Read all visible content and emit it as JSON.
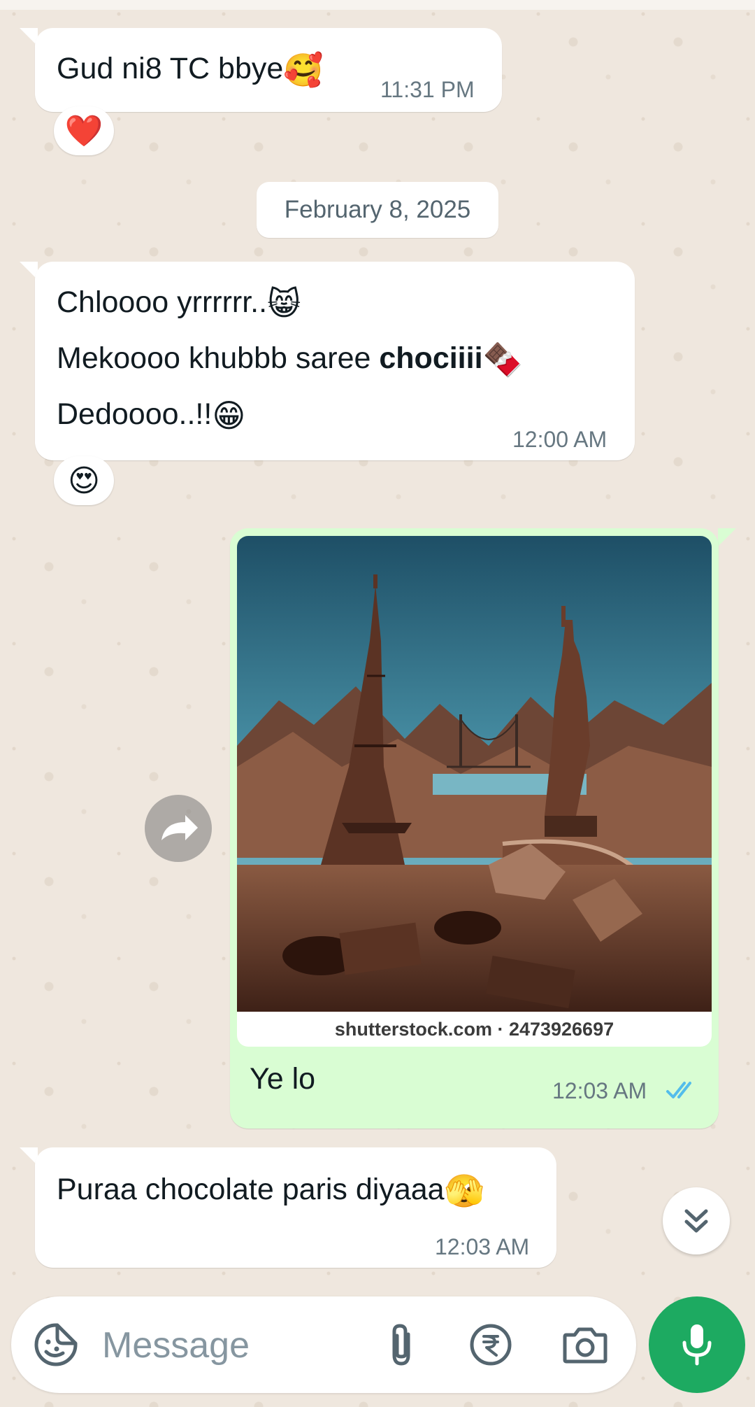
{
  "messages": [
    {
      "direction": "incoming",
      "text": "Gud ni8 TC bbye",
      "emoji": "🥰",
      "time": "11:31 PM",
      "reaction": "❤️"
    },
    {
      "direction": "incoming",
      "lines": [
        {
          "text": "Chloooo yrrrrrr..",
          "emoji": "😸"
        },
        {
          "text": "Mekoooo khubbb saree ",
          "bold": "chociiii",
          "emoji": "🍫"
        },
        {
          "text": "Dedoooo..!!",
          "emoji": "😁"
        }
      ],
      "time": "12:00 AM",
      "reaction": "😍"
    },
    {
      "direction": "outgoing",
      "image_watermark": "shutterstock.com · 2473926697",
      "caption": "Ye lo",
      "time": "12:03 AM",
      "status": "read",
      "status_color": "#53bdeb"
    },
    {
      "direction": "incoming",
      "text": "Puraa chocolate paris diyaaa",
      "emoji": "🫣",
      "time": "12:03 AM"
    }
  ],
  "date_separator": "February 8, 2025",
  "composer": {
    "placeholder": "Message",
    "icons": [
      "sticker-icon",
      "attach-icon",
      "rupee-payment-icon",
      "camera-icon",
      "mic-icon"
    ]
  },
  "buttons": {
    "forward": "forward-icon",
    "scroll_down": "chevron-double-down-icon"
  },
  "colors": {
    "outgoing_bubble": "#d9fdd3",
    "incoming_bubble": "#ffffff",
    "accent": "#1daa61",
    "wallpaper": "#efe7de"
  }
}
